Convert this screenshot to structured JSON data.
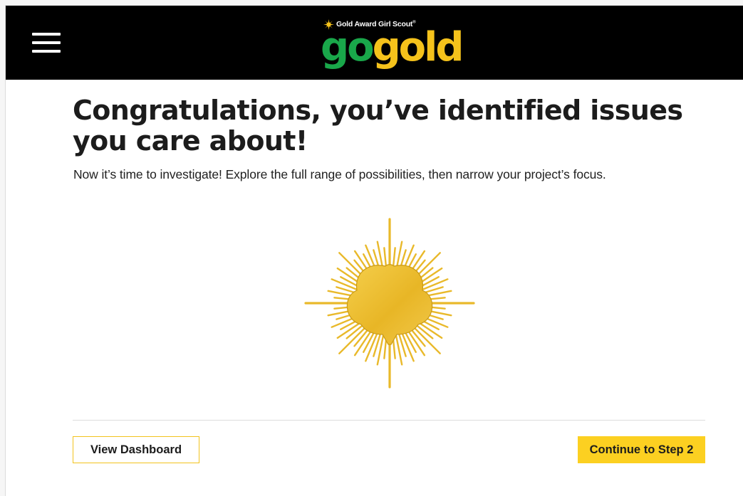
{
  "header": {
    "menu_icon": "hamburger-menu-icon",
    "logo": {
      "tagline": "Gold Award Girl Scout",
      "tagline_mark": "®",
      "word_go": "go",
      "word_gold": "gold",
      "sun_icon": "gold-award-sun-icon",
      "colors": {
        "go": "#19a74a",
        "gold": "#f5c21b"
      }
    }
  },
  "main": {
    "heading": "Congratulations, you’ve identified issues you care about!",
    "subtext": "Now it’s time to investigate! Explore the full range of possibilities, then narrow your project’s focus.",
    "badge_icon": "gold-award-trefoil-badge-icon"
  },
  "actions": {
    "view_dashboard": "View Dashboard",
    "continue": "Continue to Step 2"
  },
  "colors": {
    "header_bg": "#000000",
    "accent_yellow": "#fcd021",
    "badge_gold": "#e9b92a"
  }
}
